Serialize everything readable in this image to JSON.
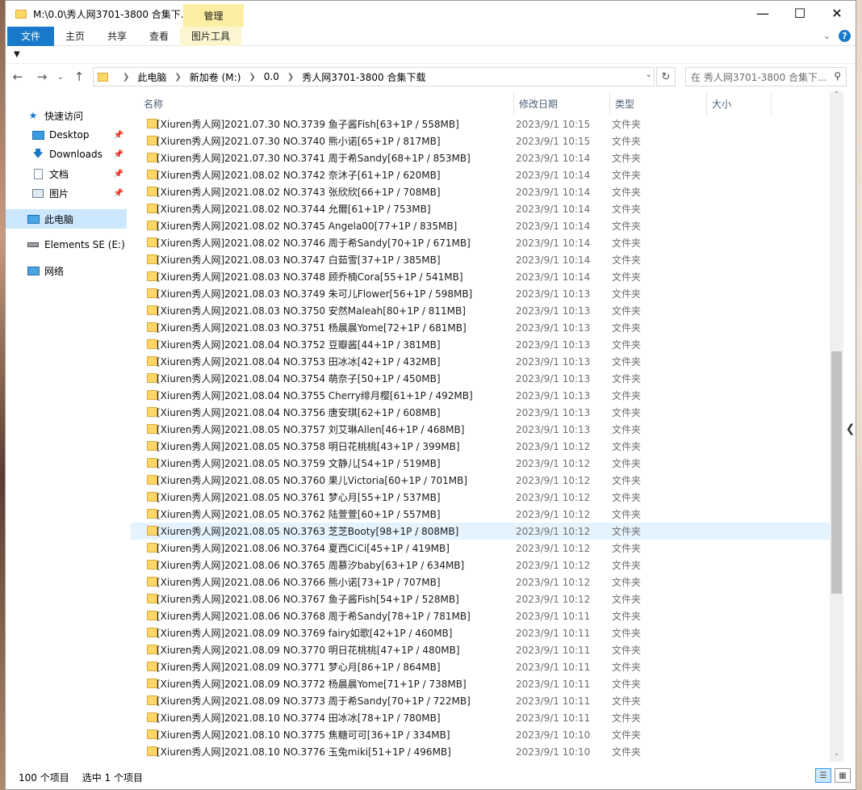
{
  "window": {
    "title": "M:\\0.0\\秀人网3701-3800 合集下...",
    "contextual_tab": "管理"
  },
  "ribbon": {
    "tabs": [
      "文件",
      "主页",
      "共享",
      "查看",
      "图片工具"
    ]
  },
  "address": {
    "crumbs": [
      "此电脑",
      "新加卷 (M:)",
      "0.0",
      "秀人网3701-3800 合集下载"
    ],
    "search_placeholder": "在 秀人网3701-3800 合集下..."
  },
  "nav": {
    "quick_access": "快速访问",
    "items": [
      "Desktop",
      "Downloads",
      "文档",
      "图片"
    ],
    "this_pc": "此电脑",
    "drive": "Elements SE (E:)",
    "network": "网络"
  },
  "columns": {
    "name": "名称",
    "date": "修改日期",
    "type": "类型",
    "size": "大小"
  },
  "files": [
    {
      "name": "[Xiuren秀人网]2021.07.30 NO.3739 鱼子酱Fish[63+1P / 558MB]",
      "date": "2023/9/1 10:15",
      "type": "文件夹"
    },
    {
      "name": "[Xiuren秀人网]2021.07.30 NO.3740 熊小诺[65+1P / 817MB]",
      "date": "2023/9/1 10:15",
      "type": "文件夹"
    },
    {
      "name": "[Xiuren秀人网]2021.07.30 NO.3741 周于希Sandy[68+1P / 853MB]",
      "date": "2023/9/1 10:14",
      "type": "文件夹"
    },
    {
      "name": "[Xiuren秀人网]2021.08.02 NO.3742 奈沐子[61+1P / 620MB]",
      "date": "2023/9/1 10:14",
      "type": "文件夹"
    },
    {
      "name": "[Xiuren秀人网]2021.08.02 NO.3743 张欣欣[66+1P / 708MB]",
      "date": "2023/9/1 10:14",
      "type": "文件夹"
    },
    {
      "name": "[Xiuren秀人网]2021.08.02 NO.3744 允爾[61+1P / 753MB]",
      "date": "2023/9/1 10:14",
      "type": "文件夹"
    },
    {
      "name": "[Xiuren秀人网]2021.08.02 NO.3745 Angela00[77+1P / 835MB]",
      "date": "2023/9/1 10:14",
      "type": "文件夹"
    },
    {
      "name": "[Xiuren秀人网]2021.08.02 NO.3746 周于希Sandy[70+1P / 671MB]",
      "date": "2023/9/1 10:14",
      "type": "文件夹"
    },
    {
      "name": "[Xiuren秀人网]2021.08.03 NO.3747 白茹雪[37+1P / 385MB]",
      "date": "2023/9/1 10:14",
      "type": "文件夹"
    },
    {
      "name": "[Xiuren秀人网]2021.08.03 NO.3748 顾乔楠Cora[55+1P / 541MB]",
      "date": "2023/9/1 10:14",
      "type": "文件夹"
    },
    {
      "name": "[Xiuren秀人网]2021.08.03 NO.3749 朱可儿Flower[56+1P / 598MB]",
      "date": "2023/9/1 10:13",
      "type": "文件夹"
    },
    {
      "name": "[Xiuren秀人网]2021.08.03 NO.3750 安然Maleah[80+1P / 811MB]",
      "date": "2023/9/1 10:13",
      "type": "文件夹"
    },
    {
      "name": "[Xiuren秀人网]2021.08.03 NO.3751 杨晨晨Yome[72+1P / 681MB]",
      "date": "2023/9/1 10:13",
      "type": "文件夹"
    },
    {
      "name": "[Xiuren秀人网]2021.08.04 NO.3752 豆瓣酱[44+1P / 381MB]",
      "date": "2023/9/1 10:13",
      "type": "文件夹"
    },
    {
      "name": "[Xiuren秀人网]2021.08.04 NO.3753 田冰冰[42+1P / 432MB]",
      "date": "2023/9/1 10:13",
      "type": "文件夹"
    },
    {
      "name": "[Xiuren秀人网]2021.08.04 NO.3754 萌奈子[50+1P / 450MB]",
      "date": "2023/9/1 10:13",
      "type": "文件夹"
    },
    {
      "name": "[Xiuren秀人网]2021.08.04 NO.3755 Cherry绯月樱[61+1P / 492MB]",
      "date": "2023/9/1 10:13",
      "type": "文件夹"
    },
    {
      "name": "[Xiuren秀人网]2021.08.04 NO.3756 唐安琪[62+1P / 608MB]",
      "date": "2023/9/1 10:13",
      "type": "文件夹"
    },
    {
      "name": "[Xiuren秀人网]2021.08.05 NO.3757 刘艾琳Allen[46+1P / 468MB]",
      "date": "2023/9/1 10:13",
      "type": "文件夹"
    },
    {
      "name": "[Xiuren秀人网]2021.08.05 NO.3758 明日花桃桃[43+1P / 399MB]",
      "date": "2023/9/1 10:12",
      "type": "文件夹"
    },
    {
      "name": "[Xiuren秀人网]2021.08.05 NO.3759 文静儿[54+1P / 519MB]",
      "date": "2023/9/1 10:12",
      "type": "文件夹"
    },
    {
      "name": "[Xiuren秀人网]2021.08.05 NO.3760 果儿Victoria[60+1P / 701MB]",
      "date": "2023/9/1 10:12",
      "type": "文件夹"
    },
    {
      "name": "[Xiuren秀人网]2021.08.05 NO.3761 梦心月[55+1P / 537MB]",
      "date": "2023/9/1 10:12",
      "type": "文件夹"
    },
    {
      "name": "[Xiuren秀人网]2021.08.05 NO.3762 陆萱萱[60+1P / 557MB]",
      "date": "2023/9/1 10:12",
      "type": "文件夹"
    },
    {
      "name": "[Xiuren秀人网]2021.08.05 NO.3763 芝芝Booty[98+1P / 808MB]",
      "date": "2023/9/1 10:12",
      "type": "文件夹"
    },
    {
      "name": "[Xiuren秀人网]2021.08.06 NO.3764 夏西CiCi[45+1P / 419MB]",
      "date": "2023/9/1 10:12",
      "type": "文件夹"
    },
    {
      "name": "[Xiuren秀人网]2021.08.06 NO.3765 周慕汐baby[63+1P / 634MB]",
      "date": "2023/9/1 10:12",
      "type": "文件夹"
    },
    {
      "name": "[Xiuren秀人网]2021.08.06 NO.3766 熊小诺[73+1P / 707MB]",
      "date": "2023/9/1 10:12",
      "type": "文件夹"
    },
    {
      "name": "[Xiuren秀人网]2021.08.06 NO.3767 鱼子酱Fish[54+1P / 528MB]",
      "date": "2023/9/1 10:12",
      "type": "文件夹"
    },
    {
      "name": "[Xiuren秀人网]2021.08.06 NO.3768 周于希Sandy[78+1P / 781MB]",
      "date": "2023/9/1 10:11",
      "type": "文件夹"
    },
    {
      "name": "[Xiuren秀人网]2021.08.09 NO.3769 fairy如歌[42+1P / 460MB]",
      "date": "2023/9/1 10:11",
      "type": "文件夹"
    },
    {
      "name": "[Xiuren秀人网]2021.08.09 NO.3770 明日花桃桃[47+1P / 480MB]",
      "date": "2023/9/1 10:11",
      "type": "文件夹"
    },
    {
      "name": "[Xiuren秀人网]2021.08.09 NO.3771 梦心月[86+1P / 864MB]",
      "date": "2023/9/1 10:11",
      "type": "文件夹"
    },
    {
      "name": "[Xiuren秀人网]2021.08.09 NO.3772 杨晨晨Yome[71+1P / 738MB]",
      "date": "2023/9/1 10:11",
      "type": "文件夹"
    },
    {
      "name": "[Xiuren秀人网]2021.08.09 NO.3773 周于希Sandy[70+1P / 722MB]",
      "date": "2023/9/1 10:11",
      "type": "文件夹"
    },
    {
      "name": "[Xiuren秀人网]2021.08.10 NO.3774 田冰冰[78+1P / 780MB]",
      "date": "2023/9/1 10:11",
      "type": "文件夹"
    },
    {
      "name": "[Xiuren秀人网]2021.08.10 NO.3775 焦糖可可[36+1P / 334MB]",
      "date": "2023/9/1 10:10",
      "type": "文件夹"
    },
    {
      "name": "[Xiuren秀人网]2021.08.10 NO.3776 玉兔miki[51+1P / 496MB]",
      "date": "2023/9/1 10:10",
      "type": "文件夹"
    }
  ],
  "selected_index": 24,
  "status": {
    "count": "100 个项目",
    "selected": "选中 1 个项目"
  },
  "colors": {
    "accent": "#1979ca",
    "folder": "#ffd766",
    "selection": "#e5f3ff",
    "manage_tab": "#fcefa3"
  }
}
